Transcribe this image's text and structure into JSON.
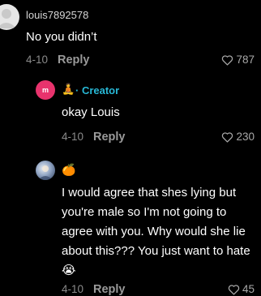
{
  "comments": [
    {
      "username": "louis7892578",
      "text": "No you didn’t",
      "date": "4-10",
      "reply_label": "Reply",
      "likes": "787"
    },
    {
      "avatar_letter": "m",
      "user_emoji": "🧘",
      "creator_label": "· Creator",
      "text": "okay Louis",
      "date": "4-10",
      "reply_label": "Reply",
      "likes": "230"
    },
    {
      "user_emoji": "🍊",
      "text": "I would agree that shes lying but you're male so I'm not going to agree with you. Why would she lie about this??? You just want to hate 😭",
      "date": "4-10",
      "reply_label": "Reply",
      "likes": "45"
    }
  ],
  "colors": {
    "background": "#000000",
    "creator_accent": "#28b8d6",
    "creator_avatar": "#e8336d"
  }
}
